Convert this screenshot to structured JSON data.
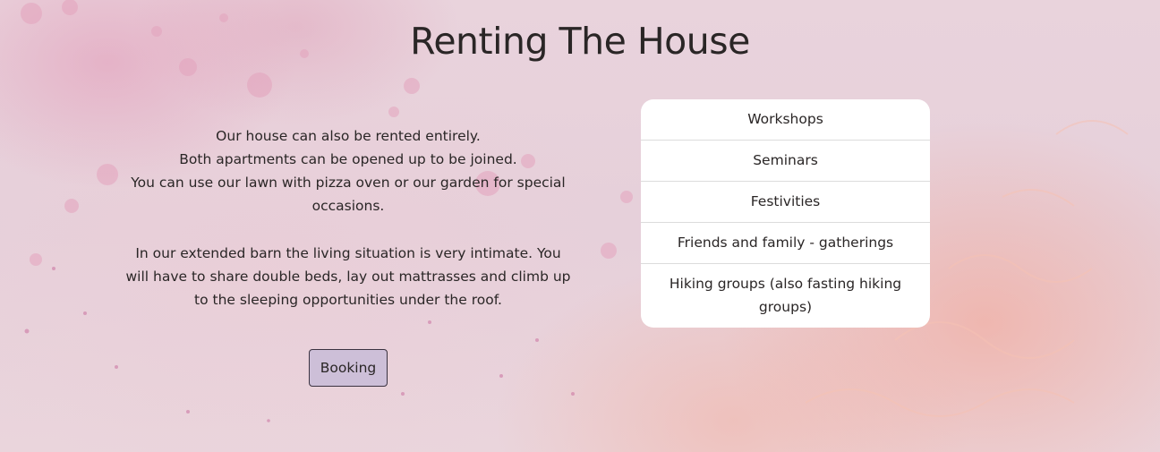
{
  "page": {
    "title": "Renting The House"
  },
  "intro": {
    "lines_1": [
      "Our house can also be rented entirely.",
      "Both apartments can be opened up to be joined.",
      "You can use our lawn with pizza oven or our garden for special occasions."
    ],
    "paragraph_2": "In our extended barn the living situation is very intimate. You will have to share double beds, lay out mattrasses and climb up to the sleeping opportunities under the roof."
  },
  "booking_button": {
    "label": "Booking"
  },
  "uses": {
    "items": [
      {
        "label": "Workshops"
      },
      {
        "label": "Seminars"
      },
      {
        "label": "Festivities"
      },
      {
        "label": "Friends and family - gatherings"
      },
      {
        "label": "Hiking groups (also fasting hiking groups)"
      }
    ]
  },
  "colors": {
    "button_bg": "#cdbfd8",
    "card_bg": "#ffffff",
    "text": "#2a2626"
  }
}
